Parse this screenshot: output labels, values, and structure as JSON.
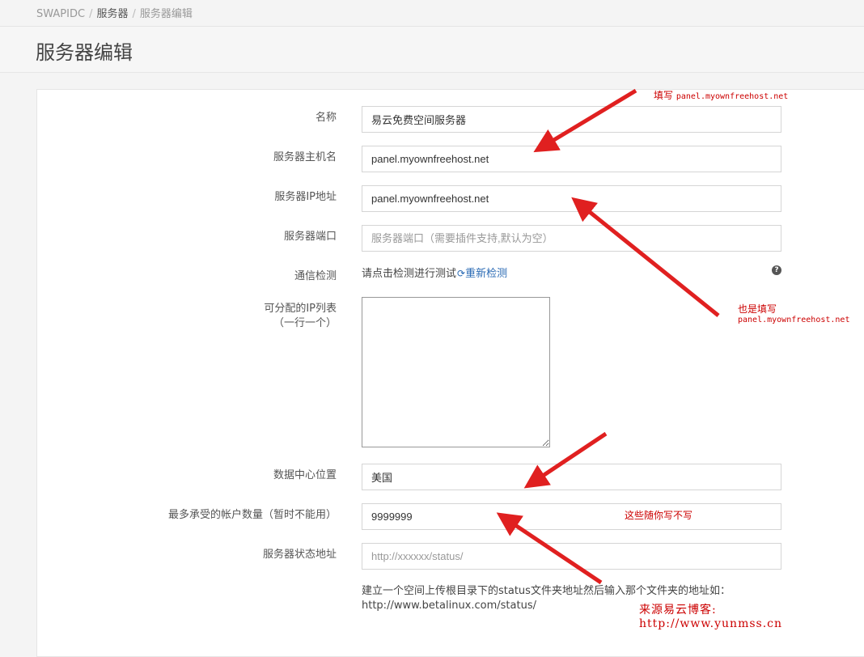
{
  "breadcrumb": {
    "root": "SWAPIDC",
    "parent": "服务器",
    "current": "服务器编辑",
    "sep": "/"
  },
  "page_title": "服务器编辑",
  "form": {
    "name_label": "名称",
    "name_value": "易云免费空间服务器",
    "hostname_label": "服务器主机名",
    "hostname_value": "panel.myownfreehost.net",
    "ip_label": "服务器IP地址",
    "ip_value": "panel.myownfreehost.net",
    "port_label": "服务器端口",
    "port_placeholder": "服务器端口（需要插件支持,默认为空）",
    "comm_label": "通信检测",
    "comm_text": "请点击检测进行测试",
    "comm_link": "重新检测",
    "help_icon": "?",
    "ip_list_label_1": "可分配的IP列表",
    "ip_list_label_2": "（一行一个）",
    "dc_label": "数据中心位置",
    "dc_value": "美国",
    "max_accounts_label": "最多承受的帐户数量（暂时不能用）",
    "max_accounts_value": "9999999",
    "status_label": "服务器状态地址",
    "status_placeholder": "http://xxxxxx/status/",
    "status_help_1": "建立一个空间上传根目录下的status文件夹地址然后输入那个文件夹的地址如：",
    "status_help_2": "http://www.betalinux.com/status/"
  },
  "annotations": {
    "a1_text": "填写",
    "a1_mono": "panel.myownfreehost.net",
    "a2_text": "也是填写",
    "a2_mono": "panel.myownfreehost.net",
    "a3_text": "这些随你写不写",
    "watermark": "来源易云博客: http://www.yunmss.cn",
    "color": "#e02020"
  },
  "icons": {
    "refresh": "refresh-icon",
    "help": "question-circle-icon"
  }
}
